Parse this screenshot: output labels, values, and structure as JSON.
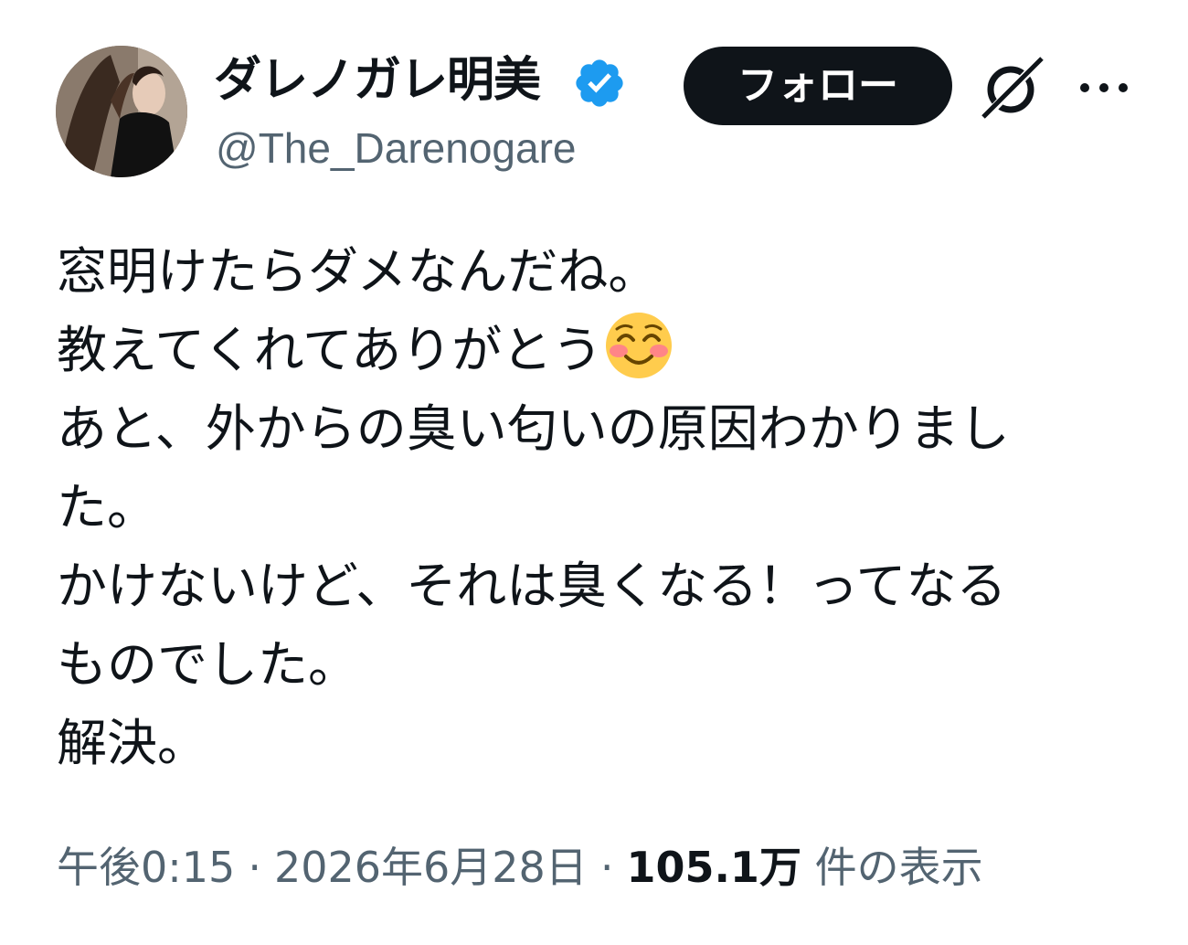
{
  "author": {
    "display_name": "ダレノガレ明美",
    "handle": "@The_Darenogare",
    "verified_icon": "verified-badge-icon",
    "verified_color": "#1d9bf0"
  },
  "actions": {
    "follow_label": "フォロー",
    "grok_icon": "grok-icon",
    "more_icon": "more-icon"
  },
  "tweet": {
    "lines": [
      "窓明けたらダメなんだね。",
      "教えてくれてありがとう",
      "あと、外からの臭い匂いの原因わかりまし",
      "た。",
      "かけないけど、それは臭くなる！ってなる",
      "ものでした。",
      "解決。"
    ],
    "emoji_icon": "smiling-face-with-smiling-eyes-icon"
  },
  "meta": {
    "time": "午後0:15",
    "separator": "·",
    "date": "2026年6月28日",
    "views_count": "105.1万",
    "views_label": "件の表示"
  },
  "colors": {
    "text_primary": "#0f1419",
    "text_secondary": "#536471",
    "button_bg": "#0f1419"
  }
}
